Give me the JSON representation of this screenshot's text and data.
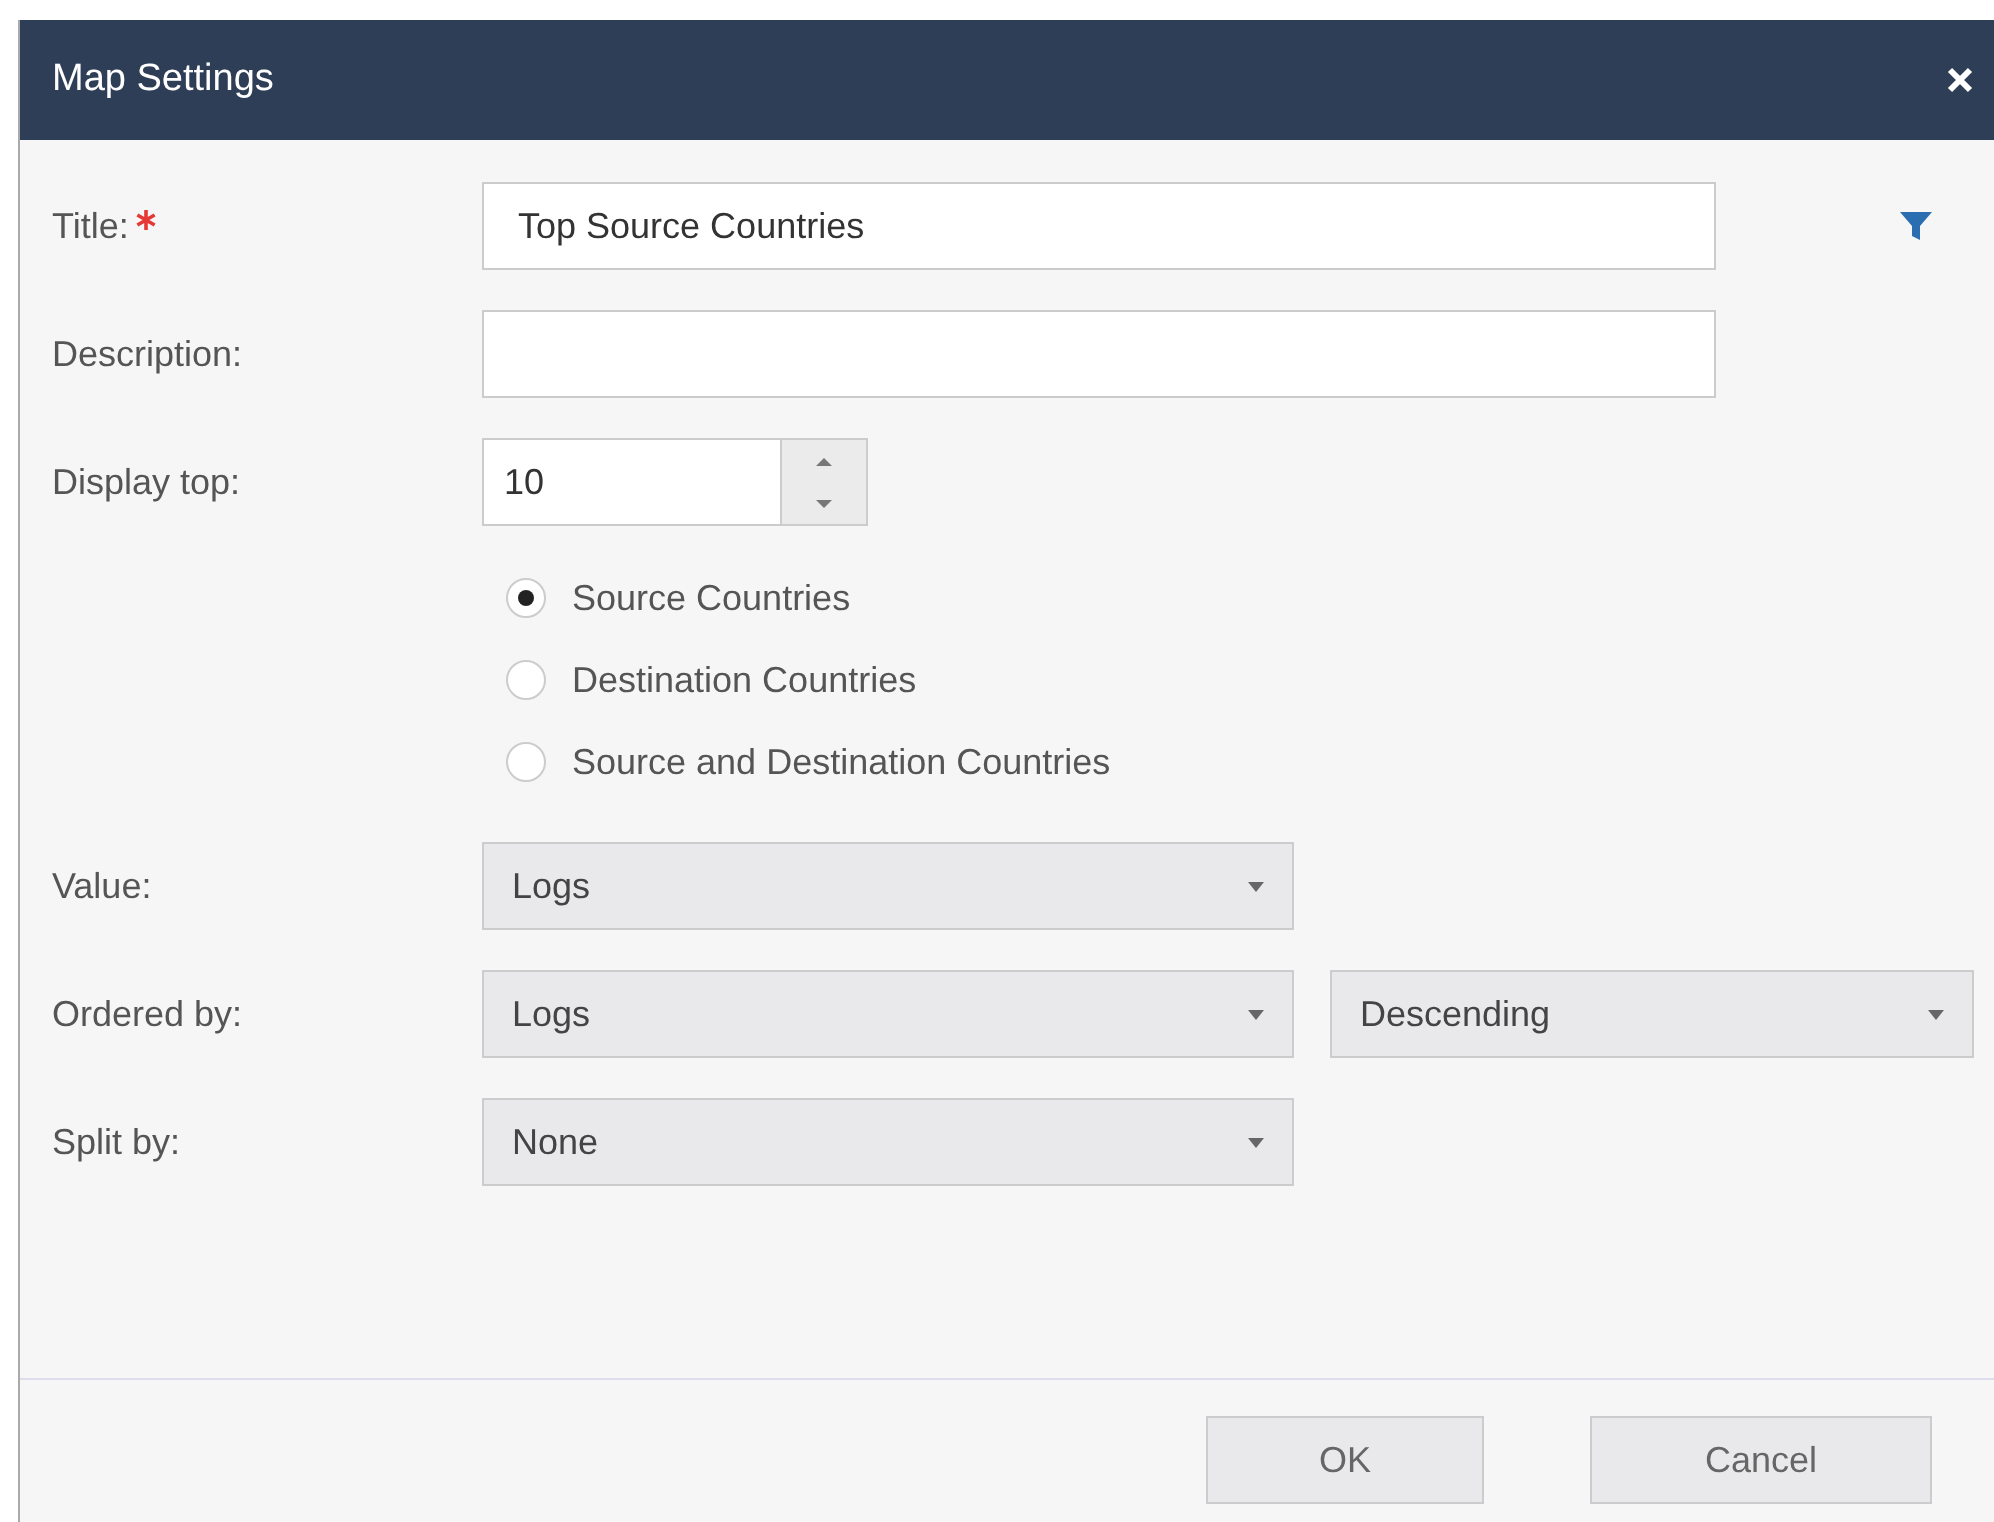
{
  "window": {
    "title": "Map Settings"
  },
  "fields": [
    {
      "label": "Title:",
      "required": true,
      "kind": "text",
      "value": "Top Source Countries"
    },
    {
      "label": "Description:",
      "required": false,
      "kind": "text"
    },
    {
      "label": "Display top:",
      "required": false,
      "kind": "number",
      "value": "10"
    }
  ],
  "radios": [
    {
      "label": "Source Countries",
      "selected": true
    },
    {
      "label": "Destination Countries",
      "selected": false
    },
    {
      "label": "Source and Destination Countries",
      "selected": false
    }
  ],
  "selects": [
    {
      "label": "Value:",
      "dropdowns": [
        "Logs"
      ]
    },
    {
      "label": "Ordered by:",
      "dropdowns": [
        "Logs",
        "Descending"
      ]
    },
    {
      "label": "Split by:",
      "dropdowns": [
        "None"
      ]
    }
  ],
  "buttons": [
    "OK",
    "Cancel"
  ]
}
